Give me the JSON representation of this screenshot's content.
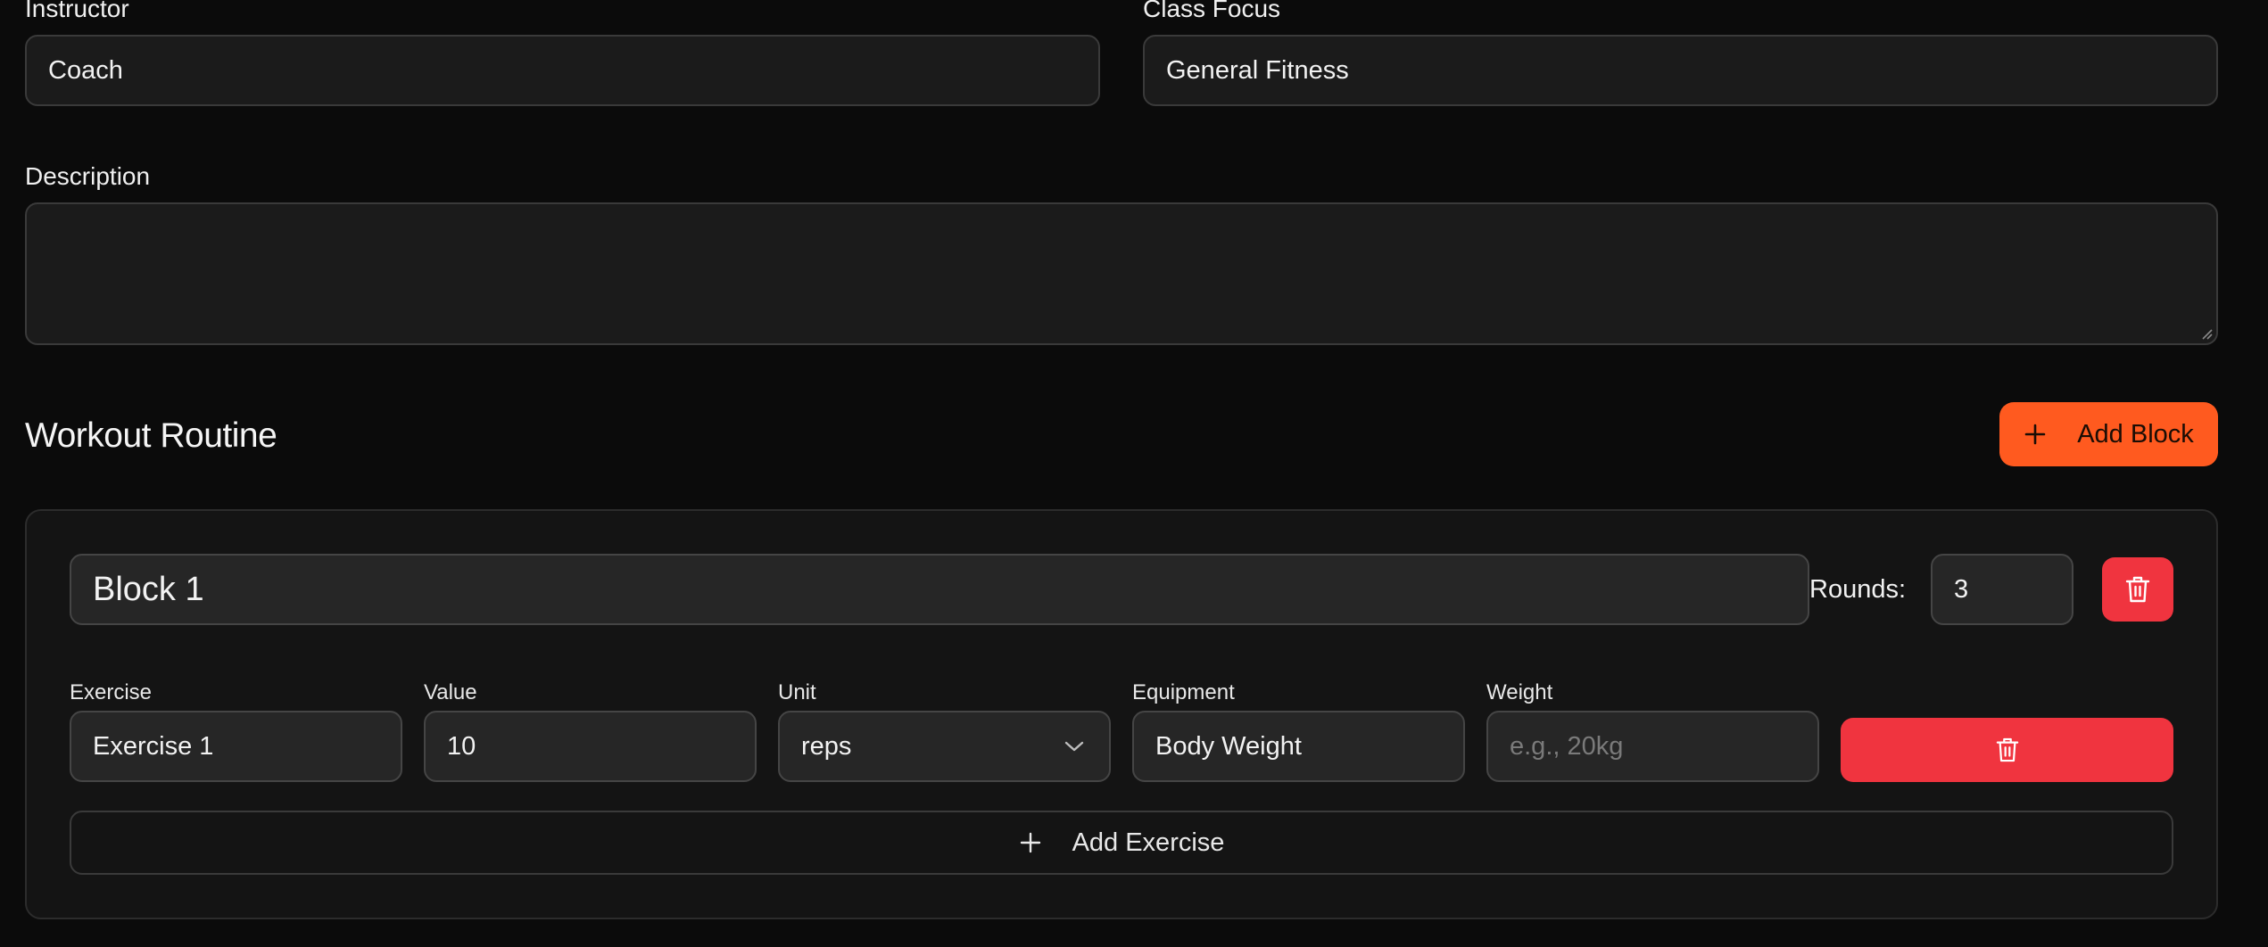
{
  "fields": {
    "instructor": {
      "label": "Instructor",
      "value": "Coach"
    },
    "class_focus": {
      "label": "Class Focus",
      "value": "General Fitness"
    },
    "description": {
      "label": "Description",
      "value": ""
    }
  },
  "routine": {
    "title": "Workout Routine",
    "add_block_label": "Add Block",
    "blocks": [
      {
        "name": "Block 1",
        "rounds_label": "Rounds:",
        "rounds": "3",
        "columns": [
          "Exercise",
          "Value",
          "Unit",
          "Equipment",
          "Weight"
        ],
        "exercises": [
          {
            "exercise": "Exercise 1",
            "value": "10",
            "unit": "reps",
            "equipment": "Body Weight",
            "weight": "",
            "weight_placeholder": "e.g., 20kg"
          }
        ],
        "add_exercise_label": "Add Exercise"
      }
    ]
  },
  "colors": {
    "accent": "#ff5a1f",
    "danger": "#f0343f",
    "background": "#0b0b0b"
  },
  "icons": {
    "add": "plus-icon",
    "delete": "trash-icon",
    "dropdown": "chevron-down-icon"
  }
}
